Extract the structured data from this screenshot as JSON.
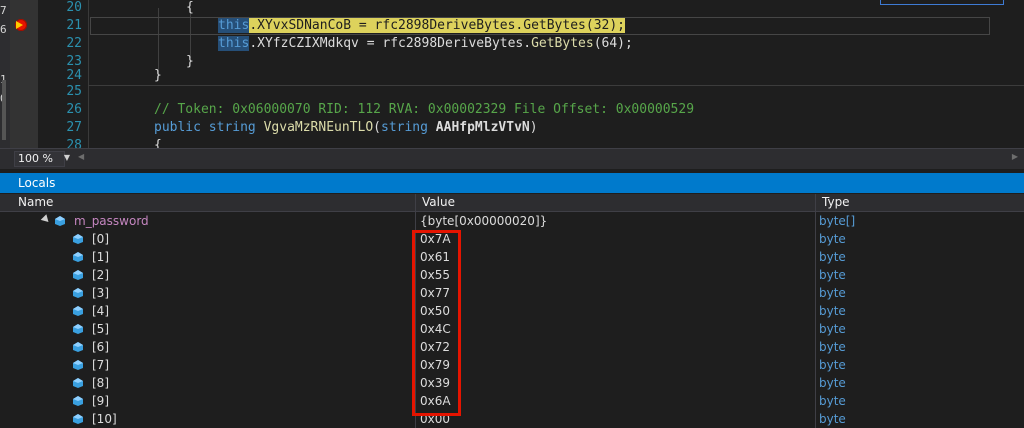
{
  "edge_marks": [
    "7",
    "6",
    "1",
    "0"
  ],
  "editor": {
    "lines": [
      {
        "num": "20"
      },
      {
        "num": "21"
      },
      {
        "num": "22"
      },
      {
        "num": "23"
      },
      {
        "num": "24"
      },
      {
        "num": "25"
      },
      {
        "num": "26"
      },
      {
        "num": "27"
      },
      {
        "num": "28"
      }
    ],
    "code": {
      "l20_brace": "{",
      "l21_this": "this",
      "l21_field": "XYvxSDNanCoB",
      "l21_assign": " = rfc2898DeriveBytes.",
      "l21_method": "GetBytes",
      "l21_args": "(32);",
      "l22_this": "this",
      "l22_dot": ".",
      "l22_field": "XYfzCZIXMdkqv",
      "l22_assign": " = rfc2898DeriveBytes.",
      "l22_method": "GetBytes",
      "l22_args": "(64);",
      "l23_brace": "}",
      "l24_brace": "}",
      "l26_comment": "// Token: 0x06000070 RID: 112 RVA: 0x00002329 File Offset: 0x00000529",
      "l27_public": "public",
      "l27_string": "string",
      "l27_method": "VgvaMzRNEunTLO",
      "l27_paren": "(",
      "l27_string2": "string",
      "l27_param": "AAHfpMlzVTvN",
      "l27_close": ")",
      "l28_brace": "{"
    }
  },
  "zoom": {
    "value": "100 %"
  },
  "locals": {
    "title": "Locals",
    "columns": {
      "name": "Name",
      "value": "Value",
      "type": "Type"
    },
    "parent": {
      "name": "m_password",
      "value": "{byte[0x00000020]}",
      "type": "byte[]"
    },
    "items": [
      {
        "name": "[0]",
        "value": "0x7A",
        "type": "byte"
      },
      {
        "name": "[1]",
        "value": "0x61",
        "type": "byte"
      },
      {
        "name": "[2]",
        "value": "0x55",
        "type": "byte"
      },
      {
        "name": "[3]",
        "value": "0x77",
        "type": "byte"
      },
      {
        "name": "[4]",
        "value": "0x50",
        "type": "byte"
      },
      {
        "name": "[5]",
        "value": "0x4C",
        "type": "byte"
      },
      {
        "name": "[6]",
        "value": "0x72",
        "type": "byte"
      },
      {
        "name": "[7]",
        "value": "0x79",
        "type": "byte"
      },
      {
        "name": "[8]",
        "value": "0x39",
        "type": "byte"
      },
      {
        "name": "[9]",
        "value": "0x6A",
        "type": "byte"
      },
      {
        "name": "[10]",
        "value": "0x00",
        "type": "byte"
      }
    ]
  },
  "colors": {
    "accent": "#007acc",
    "highlight_box": "#e51400",
    "breakpoint": "#e51400"
  }
}
